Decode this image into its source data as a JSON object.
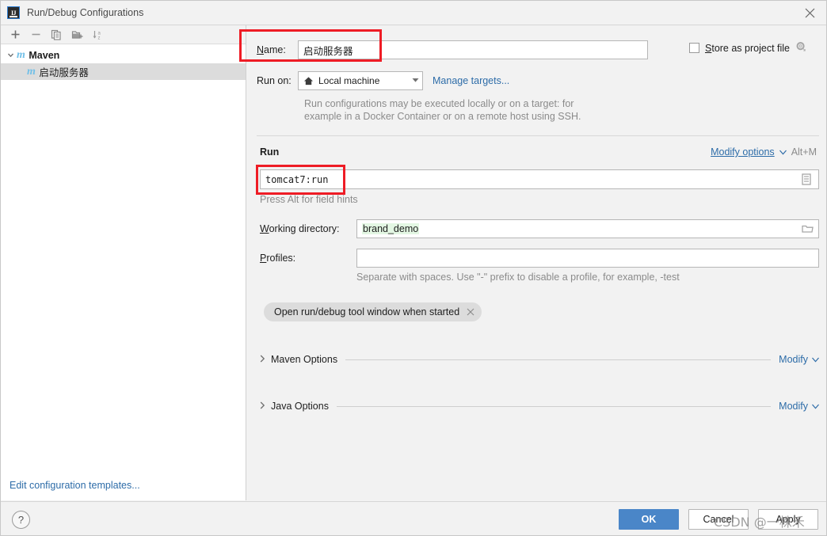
{
  "window": {
    "title": "Run/Debug Configurations",
    "app_icon": "intellij-idea-logo",
    "close_icon": "close-icon"
  },
  "sidebar": {
    "toolbar": [
      {
        "name": "add-configuration-button",
        "icon": "plus-icon",
        "glyph": "+"
      },
      {
        "name": "remove-configuration-button",
        "icon": "minus-icon",
        "glyph": "−"
      },
      {
        "name": "copy-configuration-button",
        "icon": "copy-icon",
        "glyph": "⧉"
      },
      {
        "name": "save-configuration-button",
        "icon": "folder-add-icon",
        "glyph": "◰"
      },
      {
        "name": "sort-configurations-button",
        "icon": "sort-az-icon",
        "glyph": "↓az"
      }
    ],
    "tree": [
      {
        "label": "Maven",
        "icon": "maven-icon",
        "expanded": true,
        "selected": false,
        "level": 0
      },
      {
        "label": "启动服务器",
        "icon": "maven-icon",
        "expanded": false,
        "selected": true,
        "level": 1
      }
    ],
    "edit_templates_link": "Edit configuration templates..."
  },
  "form": {
    "name_label": "Name:",
    "name_label_mnemonic": "N",
    "name_value": "启动服务器",
    "store_as_project_file_label": "Store as project file",
    "store_as_project_file_mnemonic": "S",
    "store_as_project_file_checked": false,
    "store_settings_icon": "gear-icon",
    "run_on_label": "Run on:",
    "run_on_value": "Local machine",
    "run_on_icon": "home-icon",
    "manage_targets_link": "Manage targets...",
    "target_hint_line1": "Run configurations may be executed locally or on a target: for",
    "target_hint_line2": "example in a Docker Container or on a remote host using SSH.",
    "run_section_title": "Run",
    "modify_options_link": "Modify options",
    "modify_options_shortcut": "Alt+M",
    "command_value": "tomcat7:run",
    "command_expand_icon": "expand-editor-icon",
    "command_hint": "Press Alt for field hints",
    "working_directory_label": "Working directory:",
    "working_directory_mnemonic": "W",
    "working_directory_value": "brand_demo",
    "working_directory_browse_icon": "folder-icon",
    "profiles_label": "Profiles:",
    "profiles_mnemonic": "P",
    "profiles_value": "",
    "profiles_hint": "Separate with spaces. Use \"-\" prefix to disable a profile, for example, -test",
    "option_chip_label": "Open run/debug tool window when started",
    "option_chip_close_icon": "close-icon",
    "sections": [
      {
        "title": "Maven Options",
        "modify_label": "Modify",
        "expanded": false,
        "chevron_icon": "chevron-right-icon"
      },
      {
        "title": "Java Options",
        "modify_label": "Modify",
        "expanded": false,
        "chevron_icon": "chevron-right-icon"
      }
    ]
  },
  "footer": {
    "help_label": "?",
    "help_icon": "help-icon",
    "ok_label": "OK",
    "cancel_label": "Cancel",
    "apply_label": "Apply"
  },
  "annotations": {
    "highlight_color": "#ee1c25",
    "boxes": [
      {
        "name": "name-field-highlight",
        "target": "name-row"
      },
      {
        "name": "command-field-highlight",
        "target": "command-field"
      }
    ]
  },
  "watermark": {
    "text": "CSDN @一株禾"
  },
  "colors": {
    "accent_blue": "#2d6ca8",
    "primary_button": "#4a86c8",
    "maven_icon": "#72c0e8",
    "macro_highlight": "#e3f7e3",
    "annotation_red": "#ee1c25"
  }
}
